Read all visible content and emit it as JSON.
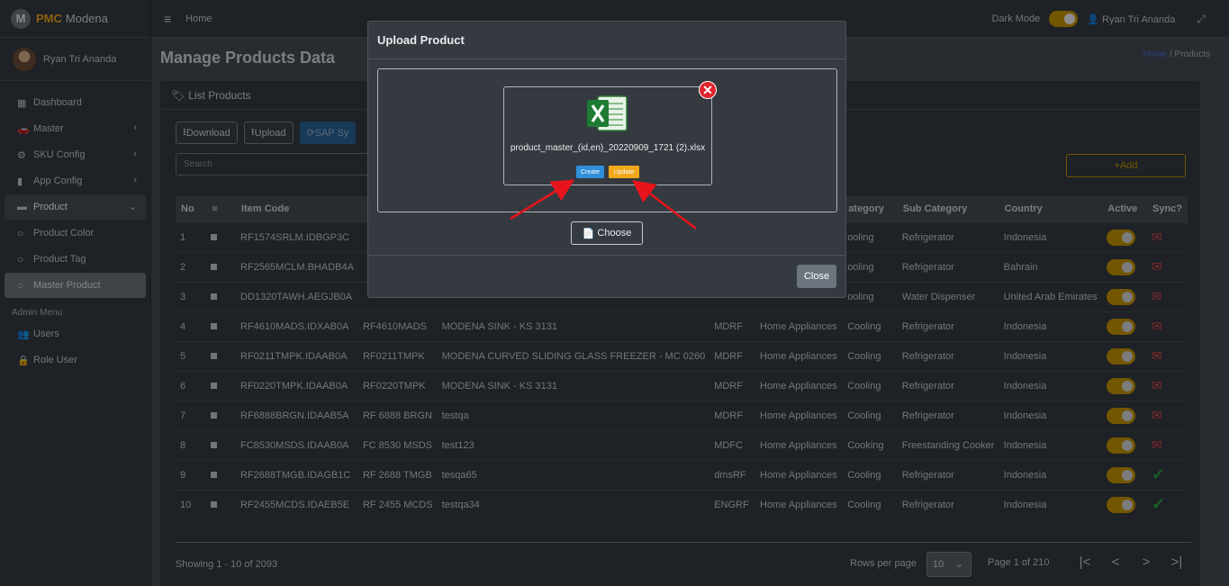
{
  "brand": {
    "logo_letter": "M",
    "bold": "PMC",
    "name": "Modena"
  },
  "user": {
    "name": "Ryan Tri Ananda"
  },
  "sidebar": {
    "items": [
      {
        "label": "Dashboard",
        "icon": "▦",
        "chev": ""
      },
      {
        "label": "Master",
        "icon": "🚗",
        "chev": "‹"
      },
      {
        "label": "SKU Config",
        "icon": "⚙",
        "chev": "‹"
      },
      {
        "label": "App Config",
        "icon": "▮",
        "chev": "‹"
      },
      {
        "label": "Product",
        "icon": "▬",
        "chev": "⌄"
      },
      {
        "label": "Product Color",
        "icon": "○",
        "chev": ""
      },
      {
        "label": "Product Tag",
        "icon": "○",
        "chev": ""
      },
      {
        "label": "Master Product",
        "icon": "○",
        "chev": ""
      }
    ],
    "admin_header": "Admin Menu",
    "admin_items": [
      {
        "label": "Users",
        "icon": "👥"
      },
      {
        "label": "Role User",
        "icon": "🔒"
      }
    ]
  },
  "topbar": {
    "home": "Home",
    "dark_mode": "Dark Mode",
    "user": "Ryan Tri Ananda",
    "menu_icon": "≡",
    "user_icon": "👤",
    "expand_icon": "⤢"
  },
  "page": {
    "title": "Manage Products Data",
    "breadcrumb_home": "Home",
    "breadcrumb_sep": "/",
    "breadcrumb_current": "Products"
  },
  "card": {
    "title": "List Products",
    "buttons": {
      "download": "Download",
      "upload": "Upload",
      "sap": "SAP Sy"
    },
    "search_placeholder": "Search",
    "add": "Add"
  },
  "table": {
    "headers": [
      "No",
      "■",
      "Item Code",
      "",
      "",
      "",
      "",
      "ategory",
      "Sub Category",
      "Country",
      "Active",
      "Sync?"
    ],
    "rows": [
      {
        "no": "1",
        "item": "RF1574SRLM.IDBGP3C",
        "code": "",
        "name": "",
        "brand": "",
        "group": "",
        "cat": "ooling",
        "sub": "Refrigerator",
        "country": "Indonesia",
        "sync": "mail"
      },
      {
        "no": "2",
        "item": "RF2565MCLM.BHADB4A",
        "code": "",
        "name": "",
        "brand": "",
        "group": "",
        "cat": "ooling",
        "sub": "Refrigerator",
        "country": "Bahrain",
        "sync": "mail"
      },
      {
        "no": "3",
        "item": "DD1320TAWH.AEGJB0A",
        "code": "",
        "name": "",
        "brand": "",
        "group": "",
        "cat": "ooling",
        "sub": "Water Dispenser",
        "country": "United Arab Emirates",
        "sync": "mail"
      },
      {
        "no": "4",
        "item": "RF4610MADS.IDXAB0A",
        "code": "RF4610MADS",
        "name": "MODENA SINK - KS 3131",
        "brand": "MDRF",
        "group": "Home Appliances",
        "cat": "Cooling",
        "sub": "Refrigerator",
        "country": "Indonesia",
        "sync": "mail"
      },
      {
        "no": "5",
        "item": "RF0211TMPK.IDAAB0A",
        "code": "RF0211TMPK",
        "name": "MODENA CURVED SLIDING GLASS FREEZER - MC 0260",
        "brand": "MDRF",
        "group": "Home Appliances",
        "cat": "Cooling",
        "sub": "Refrigerator",
        "country": "Indonesia",
        "sync": "mail"
      },
      {
        "no": "6",
        "item": "RF0220TMPK.IDAAB0A",
        "code": "RF0220TMPK",
        "name": "MODENA SINK - KS 3131",
        "brand": "MDRF",
        "group": "Home Appliances",
        "cat": "Cooling",
        "sub": "Refrigerator",
        "country": "Indonesia",
        "sync": "mail"
      },
      {
        "no": "7",
        "item": "RF6888BRGN.IDAAB5A",
        "code": "RF 6888 BRGN",
        "name": "testqa",
        "brand": "MDRF",
        "group": "Home Appliances",
        "cat": "Cooling",
        "sub": "Refrigerator",
        "country": "Indonesia",
        "sync": "mail"
      },
      {
        "no": "8",
        "item": "FC8530MSDS.IDAAB0A",
        "code": "FC 8530 MSDS",
        "name": "test123",
        "brand": "MDFC",
        "group": "Home Appliances",
        "cat": "Cooking",
        "sub": "Freestanding Cooker",
        "country": "Indonesia",
        "sync": "mail"
      },
      {
        "no": "9",
        "item": "RF2688TMGB.IDAGB1C",
        "code": "RF 2688 TMGB",
        "name": "tesqa65",
        "brand": "dmsRF",
        "group": "Home Appliances",
        "cat": "Cooling",
        "sub": "Refrigerator",
        "country": "Indonesia",
        "sync": "check"
      },
      {
        "no": "10",
        "item": "RF2455MCDS.IDAEB5E",
        "code": "RF 2455 MCDS",
        "name": "testqa34",
        "brand": "ENGRF",
        "group": "Home Appliances",
        "cat": "Cooling",
        "sub": "Refrigerator",
        "country": "Indonesia",
        "sync": "check"
      }
    ]
  },
  "footer": {
    "showing": "Showing 1 - 10 of 2093",
    "rows_per_page": "Rows per page",
    "rows_value": "10",
    "page_info": "Page 1 of 210",
    "first": "|<",
    "prev": "<",
    "next": ">",
    "last": ">|"
  },
  "modal": {
    "title": "Upload Product",
    "filename": "product_master_(id,en)_20220909_1721 (2).xlsx",
    "create": "Create",
    "update": "Update",
    "choose": "Choose",
    "close": "Close"
  },
  "colors": {
    "accent": "#c69500",
    "danger": "#e0242e",
    "success": "#28a745",
    "info": "#2f8fd8",
    "warning": "#f0a81a"
  }
}
